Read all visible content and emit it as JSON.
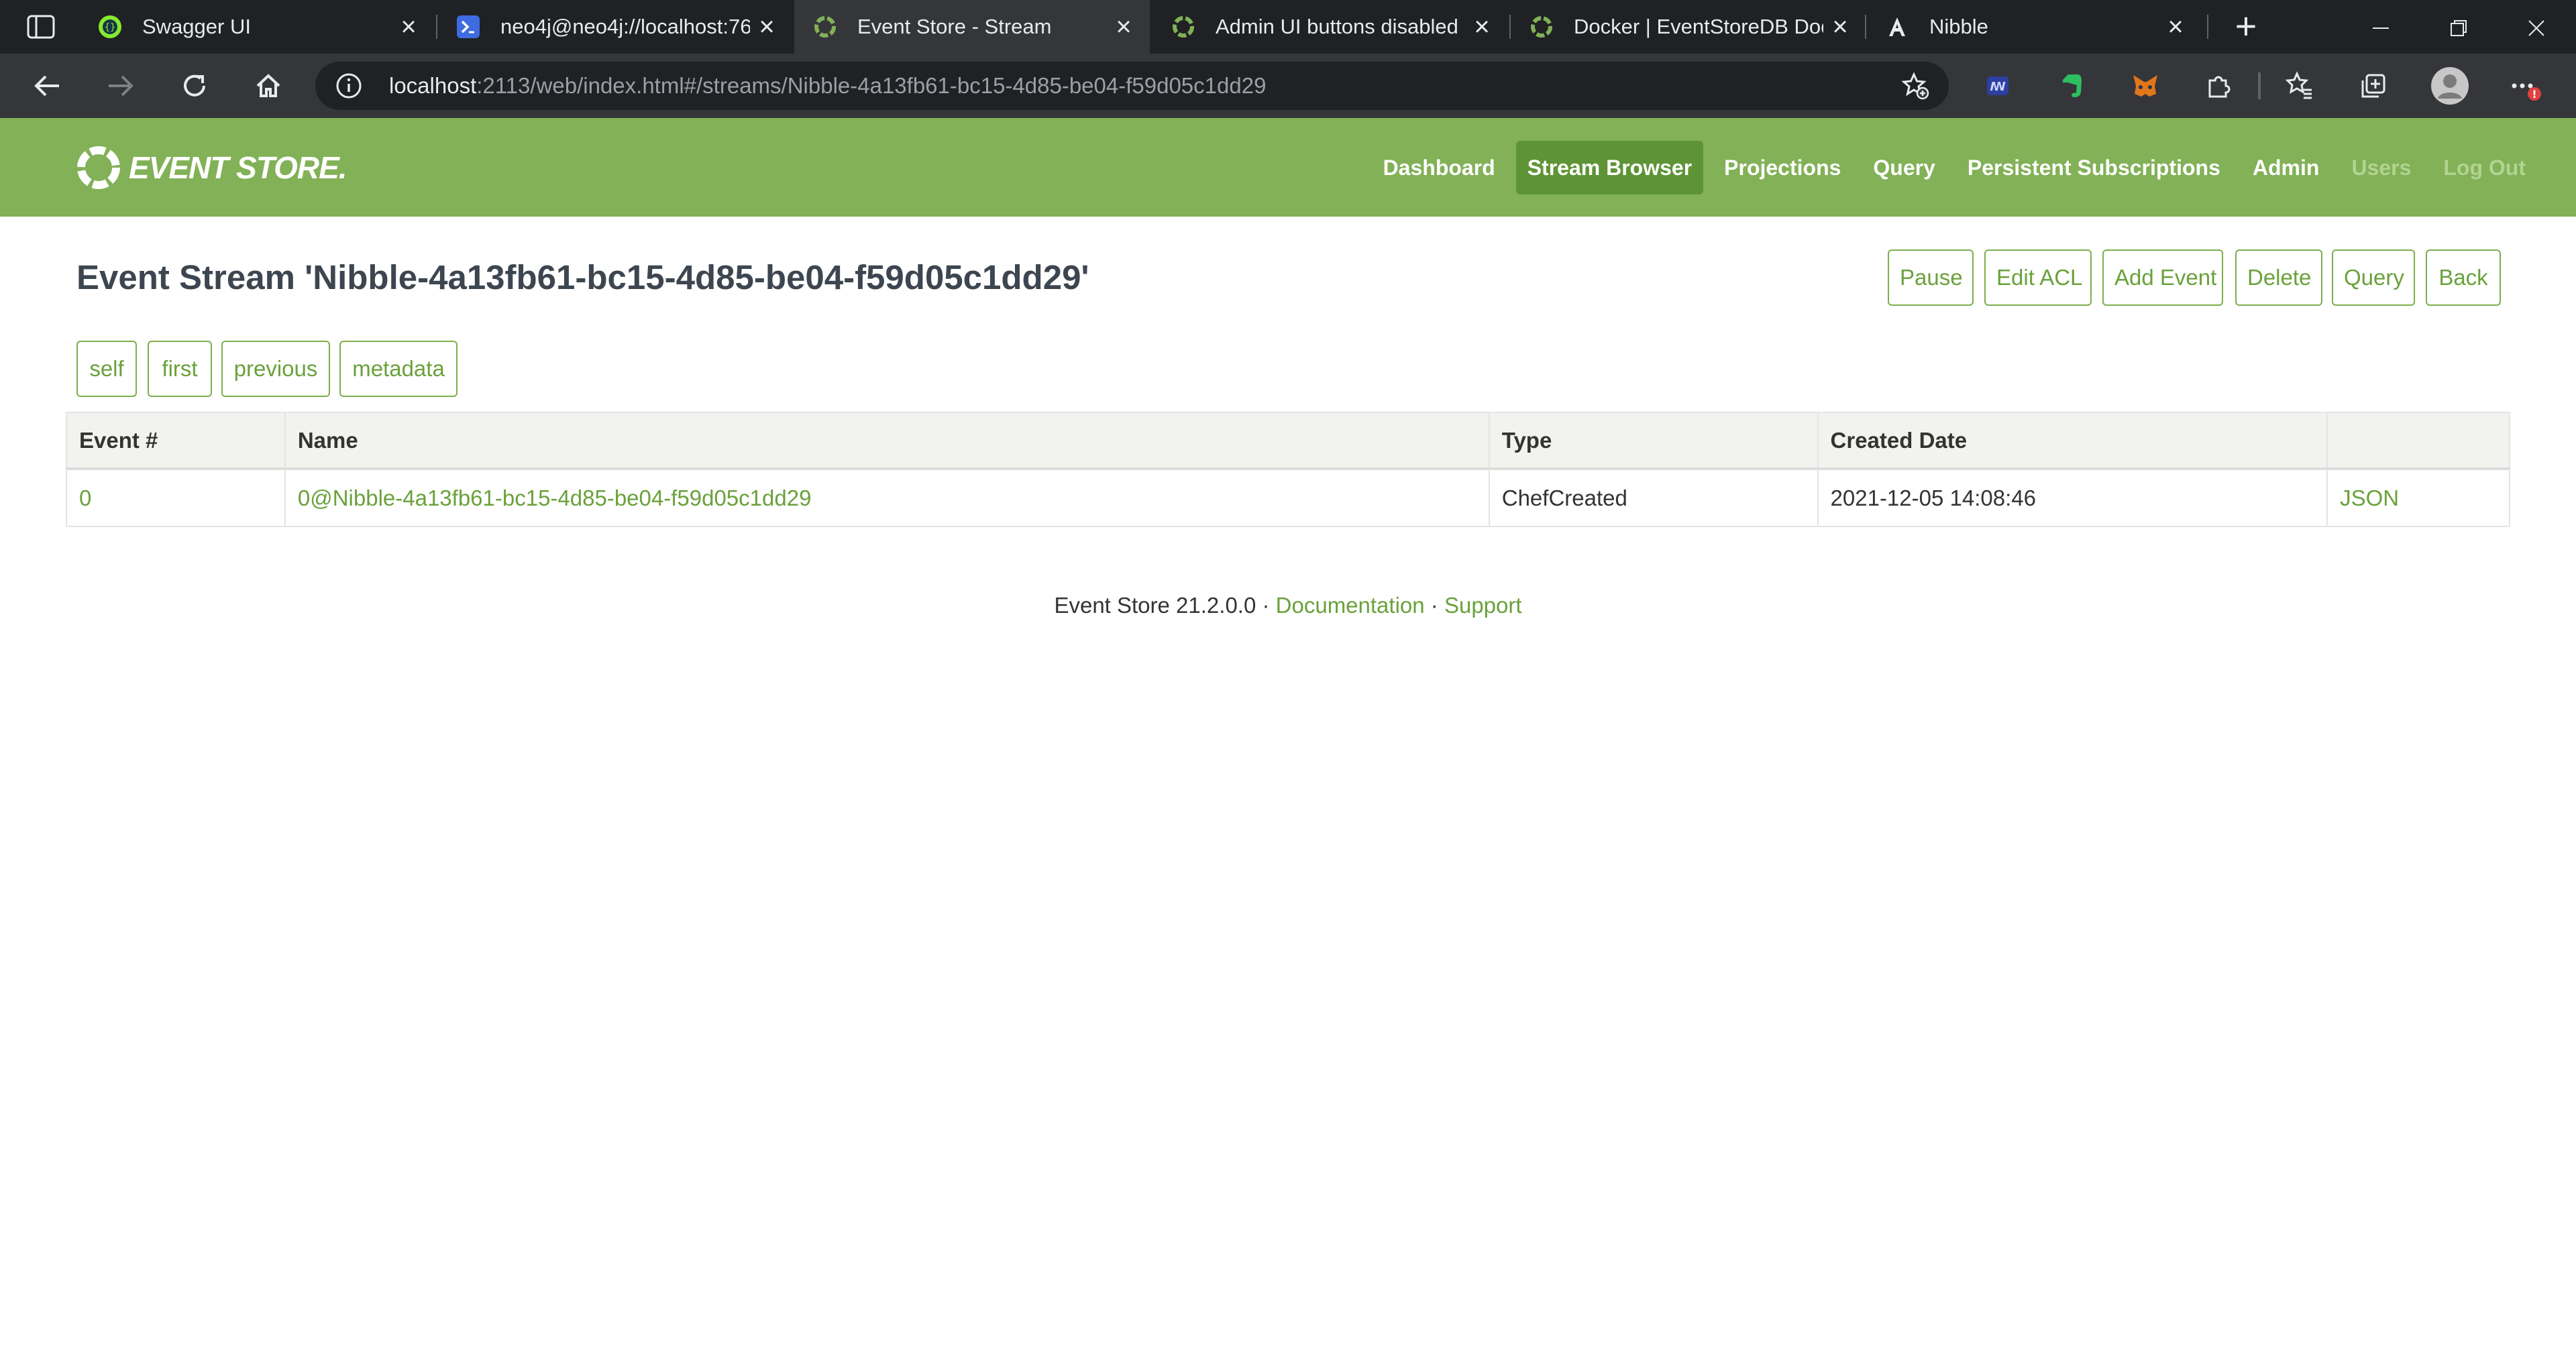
{
  "browser": {
    "tabs": [
      {
        "title": "Swagger UI",
        "icon": "swagger-icon",
        "active": false
      },
      {
        "title": "neo4j@neo4j://localhost:76",
        "icon": "terminal-icon",
        "active": false
      },
      {
        "title": "Event Store - Stream",
        "icon": "eventstore-icon",
        "active": true
      },
      {
        "title": "Admin UI buttons disabled",
        "icon": "eventstore-icon",
        "active": false
      },
      {
        "title": "Docker | EventStoreDB Doc",
        "icon": "eventstore-icon",
        "active": false
      },
      {
        "title": "Nibble",
        "icon": "angular-icon",
        "active": false
      }
    ],
    "close_glyph": "×",
    "new_tab_glyph": "+",
    "url_host": "localhost",
    "url_rest": ":2113/web/index.html#/streams/Nibble-4a13fb61-bc15-4d85-be04-f59d05c1dd29",
    "extensions": [
      "ublock-icon",
      "evernote-icon",
      "metamask-icon",
      "puzzle-icon",
      "favorites-icon",
      "collections-icon",
      "profile-icon",
      "more-icon"
    ],
    "notification_badge": "!"
  },
  "app": {
    "logo_text": "EVENT STORE.",
    "brand_color": "#82b157",
    "nav": [
      {
        "label": "Dashboard",
        "state": "normal"
      },
      {
        "label": "Stream Browser",
        "state": "active"
      },
      {
        "label": "Projections",
        "state": "normal"
      },
      {
        "label": "Query",
        "state": "normal"
      },
      {
        "label": "Persistent Subscriptions",
        "state": "normal"
      },
      {
        "label": "Admin",
        "state": "normal"
      },
      {
        "label": "Users",
        "state": "disabled"
      },
      {
        "label": "Log Out",
        "state": "disabled"
      }
    ]
  },
  "stream": {
    "title": "Event Stream 'Nibble-4a13fb61-bc15-4d85-be04-f59d05c1dd29'",
    "actions": [
      "Pause",
      "Edit ACL",
      "Add Event",
      "Delete",
      "Query",
      "Back"
    ],
    "links": [
      "self",
      "first",
      "previous",
      "metadata"
    ],
    "columns": [
      "Event #",
      "Name",
      "Type",
      "Created Date",
      ""
    ],
    "rows": [
      {
        "number": "0",
        "name": "0@Nibble-4a13fb61-bc15-4d85-be04-f59d05c1dd29",
        "type": "ChefCreated",
        "created": "2021-12-05 14:08:46",
        "json": "JSON"
      }
    ]
  },
  "footer": {
    "version": "Event Store 21.2.0.0",
    "sep": " · ",
    "documentation": "Documentation",
    "support": "Support"
  }
}
